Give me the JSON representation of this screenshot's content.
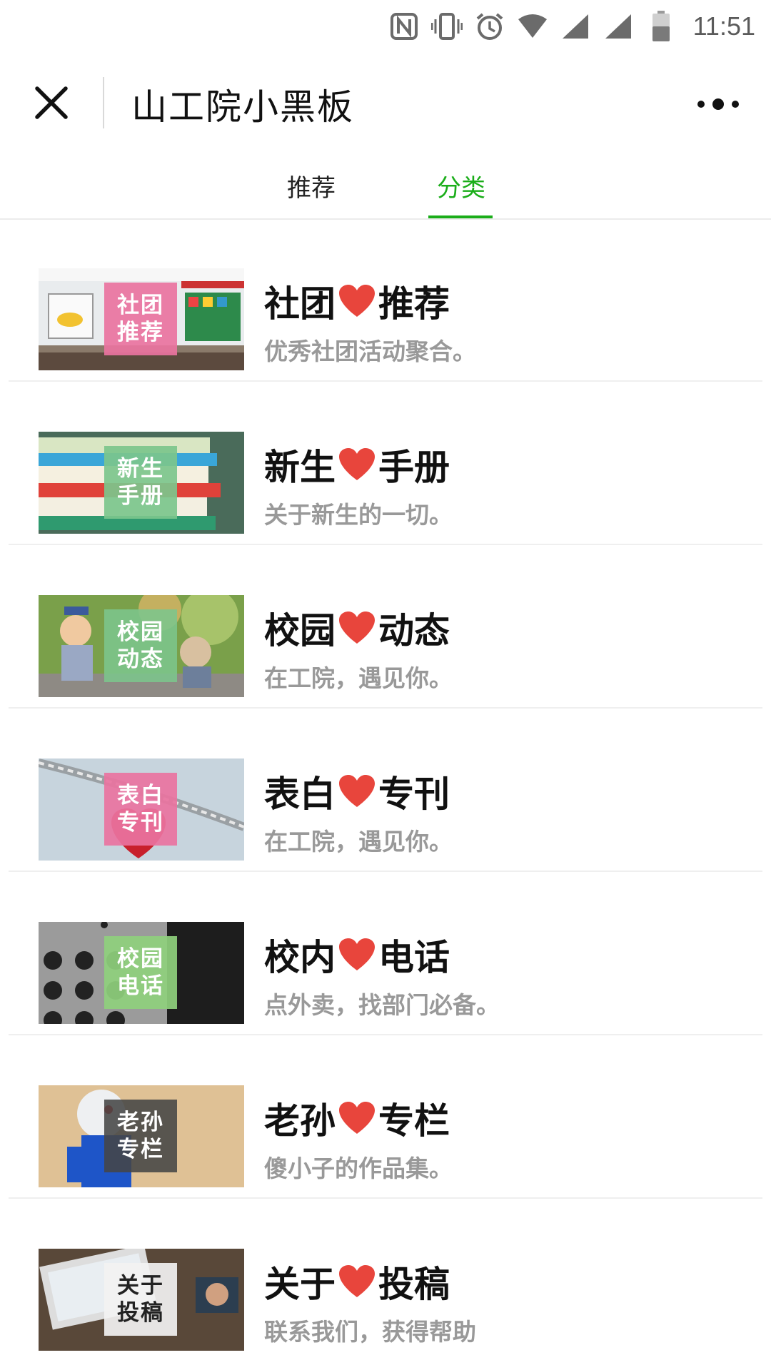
{
  "status_bar": {
    "time": "11:51",
    "icons": [
      "nfc-icon",
      "vibrate-icon",
      "alarm-icon",
      "wifi-icon",
      "signal-icon",
      "signal-icon",
      "battery-icon"
    ]
  },
  "header": {
    "title": "山工院小黑板",
    "close_icon": "close-icon",
    "more_icon": "more-icon"
  },
  "tabs": [
    {
      "label": "推荐",
      "active": false
    },
    {
      "label": "分类",
      "active": true
    }
  ],
  "colors": {
    "accent": "#1aad19",
    "heart": "#e8453c",
    "subtitle": "#999999"
  },
  "categories": [
    {
      "tag1": "社团",
      "tag2": "推荐",
      "title_left": "社团",
      "title_right": "推荐",
      "subtitle": "优秀社团活动聚合。",
      "tag_color": "#e9739f"
    },
    {
      "tag1": "新生",
      "tag2": "手册",
      "title_left": "新生",
      "title_right": "手册",
      "subtitle": "关于新生的一切。",
      "tag_color": "#7cc58c"
    },
    {
      "tag1": "校园",
      "tag2": "动态",
      "title_left": "校园",
      "title_right": "动态",
      "subtitle": "在工院，遇见你。",
      "tag_color": "#7cc58c"
    },
    {
      "tag1": "表白",
      "tag2": "专刊",
      "title_left": "表白",
      "title_right": "专刊",
      "subtitle": "在工院，遇见你。",
      "tag_color": "#e9739f"
    },
    {
      "tag1": "校园",
      "tag2": "电话",
      "title_left": "校内",
      "title_right": "电话",
      "subtitle": "点外卖，找部门必备。",
      "tag_color": "#8fd07d"
    },
    {
      "tag1": "老孙",
      "tag2": "专栏",
      "title_left": "老孙",
      "title_right": "专栏",
      "subtitle": "傻小子的作品集。",
      "tag_color": "#4a4a4a"
    },
    {
      "tag1": "关于",
      "tag2": "投稿",
      "title_left": "关于",
      "title_right": "投稿",
      "subtitle": "联系我们，获得帮助",
      "tag_color": "#f2f2f2"
    }
  ]
}
